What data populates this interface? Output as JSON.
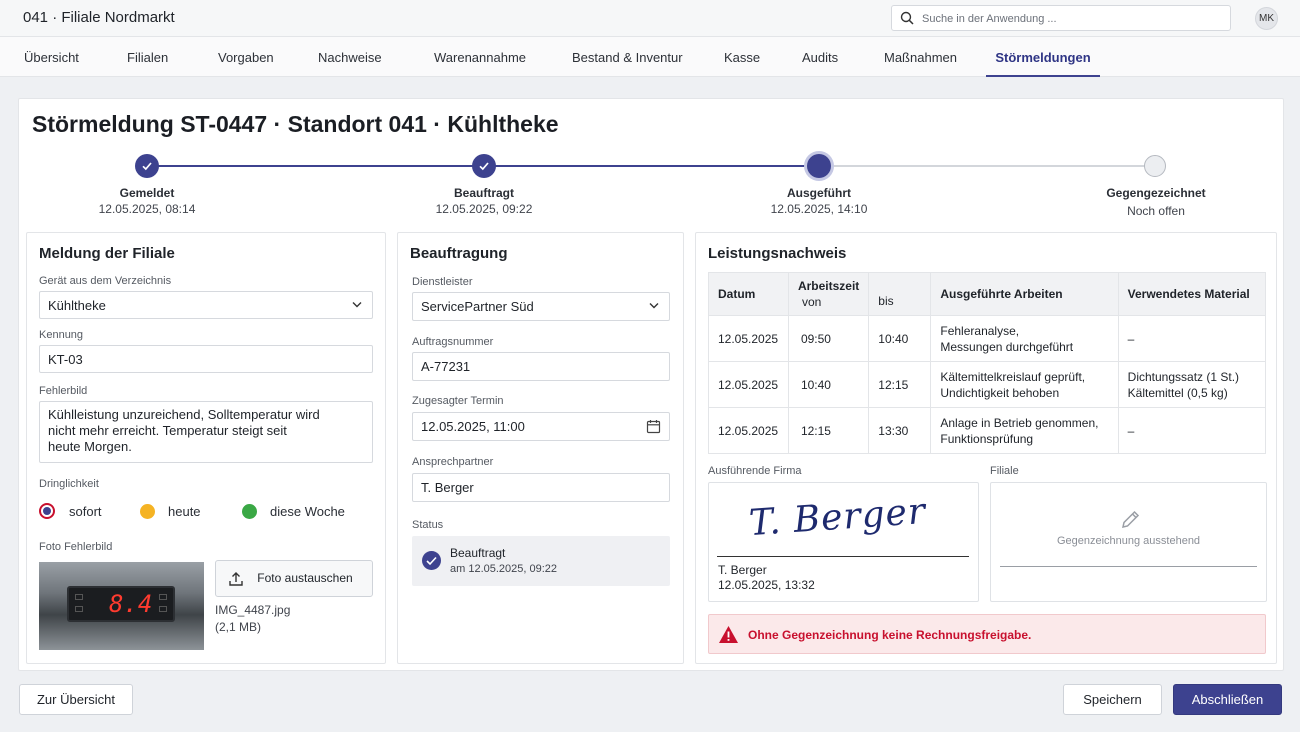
{
  "header": {
    "title": "041 · Filiale Nordmarkt",
    "search_placeholder": "Suche in der Anwendung ...",
    "avatar_initials": "MK"
  },
  "nav": {
    "tabs": [
      {
        "label": "Übersicht"
      },
      {
        "label": "Filialen"
      },
      {
        "label": "Vorgaben"
      },
      {
        "label": "Nachweise"
      },
      {
        "label": "Warenannahme"
      },
      {
        "label": "Bestand & Inventur"
      },
      {
        "label": "Kasse"
      },
      {
        "label": "Audits"
      },
      {
        "label": "Maßnahmen"
      },
      {
        "label": "Störmeldungen",
        "active": true
      }
    ]
  },
  "page": {
    "title": "Störmeldung ST-0447 · Standort 041 · Kühltheke"
  },
  "stepper": [
    {
      "label": "Gemeldet",
      "date": "12.05.2025, 08:14",
      "state": "done"
    },
    {
      "label": "Beauftragt",
      "date": "12.05.2025, 09:22",
      "state": "done"
    },
    {
      "label": "Ausgeführt",
      "date": "12.05.2025, 14:10",
      "state": "current"
    },
    {
      "label": "Gegengezeichnet",
      "date": "Noch offen",
      "state": "pending"
    }
  ],
  "meldung": {
    "title": "Meldung der Filiale",
    "device_label": "Gerät aus dem Verzeichnis",
    "device_value": "Kühltheke",
    "id_label": "Kennung",
    "id_value": "KT-03",
    "fault_label": "Fehlerbild",
    "fault_line1": "Kühlleistung unzureichend, Solltemperatur wird",
    "fault_line2": "nicht mehr erreicht. Temperatur steigt seit",
    "fault_line3": "heute Morgen.",
    "urgency_label": "Dringlichkeit",
    "urgency_options": [
      {
        "label": "sofort",
        "color": "#c8102e",
        "selected": true
      },
      {
        "label": "heute",
        "color": "#f5b324",
        "selected": false
      },
      {
        "label": "diese Woche",
        "color": "#3aa845",
        "selected": false
      }
    ],
    "photo_label": "Foto Fehlerbild",
    "photo_display": "8.4",
    "photo_button": "Foto austauschen",
    "photo_filename": "IMG_4487.jpg",
    "photo_size": "(2,1 MB)"
  },
  "beauftragung": {
    "title": "Beauftragung",
    "provider_label": "Dienstleister",
    "provider_value": "ServicePartner Süd",
    "order_label": "Auftragsnummer",
    "order_value": "A-77231",
    "date_label": "Zugesagter Termin",
    "date_value": "12.05.2025, 11:00",
    "contact_label": "Ansprechpartner",
    "contact_value": "T. Berger",
    "status_label": "Status",
    "status_value": "Beauftragt",
    "status_date": "am 12.05.2025, 09:22"
  },
  "leistungsnachweis": {
    "title": "Leistungsnachweis",
    "columns": {
      "date": "Datum",
      "work_time": "Arbeitszeit",
      "from": "von",
      "to": "bis",
      "work": "Ausgeführte Arbeiten",
      "material": "Verwendetes Material"
    },
    "rows": [
      {
        "date": "12.05.2025",
        "from": "09:50",
        "to": "10:40",
        "work1": "Fehleranalyse,",
        "work2": "Messungen durchgeführt",
        "mat1": "–",
        "mat2": ""
      },
      {
        "date": "12.05.2025",
        "from": "10:40",
        "to": "12:15",
        "work1": "Kältemittelkreislauf geprüft,",
        "work2": "Undichtigkeit behoben",
        "mat1": "Dichtungssatz (1 St.)",
        "mat2": "Kältemittel (0,5 kg)"
      },
      {
        "date": "12.05.2025",
        "from": "12:15",
        "to": "13:30",
        "work1": "Anlage in Betrieb genommen,",
        "work2": "Funktionsprüfung",
        "mat1": "–",
        "mat2": ""
      }
    ],
    "firm_label": "Ausführende Firma",
    "firm_signature": "T. Berger",
    "firm_signer": "T. Berger",
    "firm_sign_date": "12.05.2025, 13:32",
    "branch_label": "Filiale",
    "branch_pending": "Gegenzeichnung ausstehend",
    "alert_text": "Ohne Gegenzeichnung keine Rechnungsfreigabe."
  },
  "footer": {
    "back_label": "Zur Übersicht",
    "save_label": "Speichern",
    "finish_label": "Abschließen"
  },
  "colors": {
    "accent": "#3d428f",
    "danger": "#c8102e"
  }
}
